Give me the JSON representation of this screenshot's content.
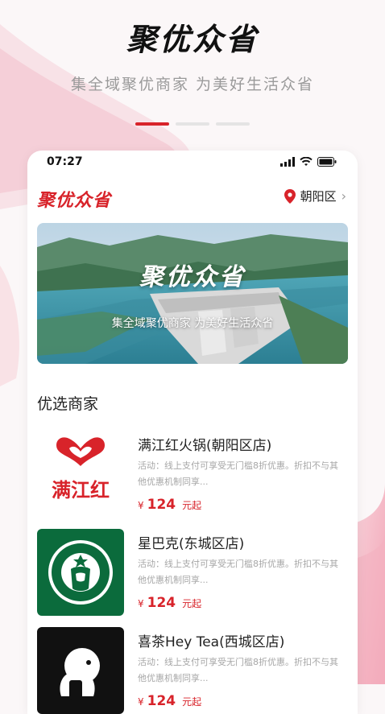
{
  "promo": {
    "title": "聚优众省",
    "subtitle": "集全域聚优商家  为美好生活众省"
  },
  "status_bar": {
    "time": "07:27"
  },
  "header": {
    "logo": "聚优众省",
    "location": "朝阳区"
  },
  "banner": {
    "title": "聚优众省",
    "subtitle": "集全域聚优商家 为美好生活众省"
  },
  "section_title": "优选商家",
  "merchants": [
    {
      "name": "满江红火锅(朝阳区店)",
      "desc": "活动：线上支付可享受无门槛8折优惠。折扣不与其他优惠机制同享...",
      "price_symbol": "¥",
      "price": "124",
      "price_unit": "元起",
      "logo_text": "满江红"
    },
    {
      "name": "星巴克(东城区店)",
      "desc": "活动：线上支付可享受无门槛8折优惠。折扣不与其他优惠机制同享...",
      "price_symbol": "¥",
      "price": "124",
      "price_unit": "元起"
    },
    {
      "name": "喜茶Hey Tea(西城区店)",
      "desc": "活动：线上支付可享受无门槛8折优惠。折扣不与其他优惠机制同享...",
      "price_symbol": "¥",
      "price": "124",
      "price_unit": "元起"
    }
  ],
  "colors": {
    "accent": "#d8232a",
    "starbucks_green": "#0b6b3c"
  }
}
